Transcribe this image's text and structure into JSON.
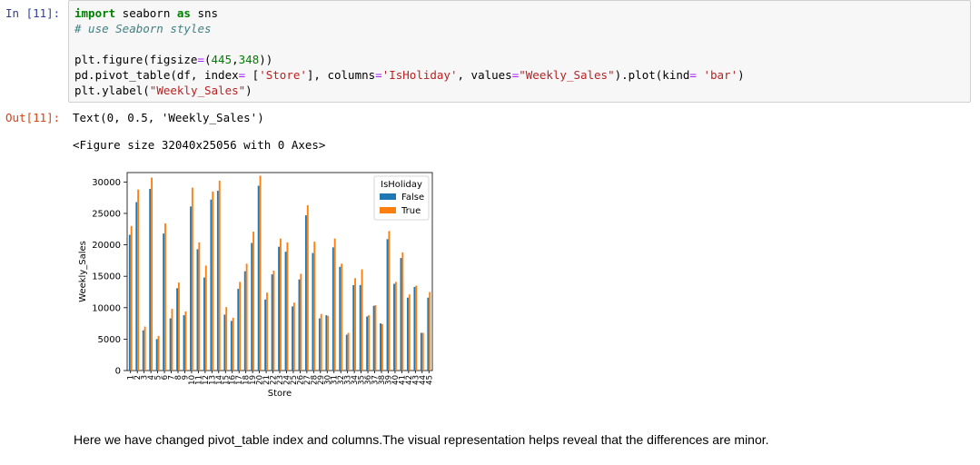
{
  "cell_in": {
    "prompt": "In [11]:",
    "lines": [
      [
        {
          "t": "import",
          "c": "kw"
        },
        {
          "t": " seaborn ",
          "c": ""
        },
        {
          "t": "as",
          "c": "kw"
        },
        {
          "t": " sns",
          "c": ""
        }
      ],
      [
        {
          "t": "# use Seaborn styles",
          "c": "cm"
        }
      ],
      [],
      [
        {
          "t": "plt.figure(figsize",
          "c": ""
        },
        {
          "t": "=",
          "c": "op"
        },
        {
          "t": "(",
          "c": ""
        },
        {
          "t": "445",
          "c": "num"
        },
        {
          "t": ",",
          "c": ""
        },
        {
          "t": "348",
          "c": "num"
        },
        {
          "t": "))",
          "c": ""
        }
      ],
      [
        {
          "t": "pd.pivot_table(df, index",
          "c": ""
        },
        {
          "t": "=",
          "c": "op"
        },
        {
          "t": " [",
          "c": ""
        },
        {
          "t": "'Store'",
          "c": "str"
        },
        {
          "t": "], columns",
          "c": ""
        },
        {
          "t": "=",
          "c": "op"
        },
        {
          "t": "'IsHoliday'",
          "c": "str"
        },
        {
          "t": ", values",
          "c": ""
        },
        {
          "t": "=",
          "c": "op"
        },
        {
          "t": "\"Weekly_Sales\"",
          "c": "str"
        },
        {
          "t": ").plot(kind",
          "c": ""
        },
        {
          "t": "=",
          "c": "op"
        },
        {
          "t": " ",
          "c": ""
        },
        {
          "t": "'bar'",
          "c": "str"
        },
        {
          "t": ")",
          "c": ""
        }
      ],
      [
        {
          "t": "plt.ylabel(",
          "c": ""
        },
        {
          "t": "\"Weekly_Sales\"",
          "c": "str"
        },
        {
          "t": ")",
          "c": ""
        }
      ]
    ]
  },
  "cell_out": {
    "prompt": "Out[11]:",
    "text_result": "Text(0, 0.5, 'Weekly_Sales')",
    "figure_repr": "<Figure size 32040x25056 with 0 Axes>"
  },
  "markdown_text": "Here we have changed pivot_table index and columns.The visual representation helps reveal that the differences are minor.",
  "chart_data": {
    "type": "bar",
    "xlabel": "Store",
    "ylabel": "Weekly_Sales",
    "ylim": [
      0,
      31500
    ],
    "yticks": [
      0,
      5000,
      10000,
      15000,
      20000,
      25000,
      30000
    ],
    "legend_title": "IsHoliday",
    "legend_position": "top-right",
    "categories": [
      "1",
      "2",
      "3",
      "4",
      "5",
      "6",
      "7",
      "8",
      "9",
      "10",
      "11",
      "12",
      "13",
      "14",
      "15",
      "16",
      "17",
      "18",
      "19",
      "20",
      "21",
      "22",
      "23",
      "24",
      "25",
      "26",
      "27",
      "28",
      "29",
      "30",
      "31",
      "32",
      "33",
      "34",
      "35",
      "36",
      "37",
      "38",
      "39",
      "40",
      "41",
      "42",
      "43",
      "44",
      "45"
    ],
    "series": [
      {
        "name": "False",
        "color": "#1f77b4",
        "values": [
          21600,
          26800,
          6400,
          28900,
          5000,
          21800,
          8300,
          13100,
          8800,
          26100,
          19300,
          14800,
          27200,
          28600,
          8900,
          7900,
          13000,
          15800,
          20300,
          29400,
          11300,
          15300,
          19700,
          18900,
          10200,
          14500,
          24700,
          18700,
          8300,
          8800,
          19600,
          16500,
          5700,
          13600,
          13600,
          8600,
          10300,
          7500,
          20900,
          13800,
          17900,
          11600,
          13300,
          6000,
          11600
        ]
      },
      {
        "name": "True",
        "color": "#ff7f0e",
        "values": [
          23000,
          28800,
          7000,
          30700,
          5500,
          23400,
          9800,
          14000,
          9400,
          29100,
          20400,
          16700,
          28500,
          30200,
          10100,
          8400,
          14100,
          17000,
          22100,
          31000,
          12400,
          15900,
          21000,
          20400,
          10800,
          15400,
          26300,
          20500,
          9000,
          8700,
          21000,
          17000,
          6000,
          14700,
          16100,
          8800,
          10400,
          7400,
          22200,
          14100,
          18800,
          12100,
          13500,
          6000,
          12500
        ]
      }
    ]
  }
}
